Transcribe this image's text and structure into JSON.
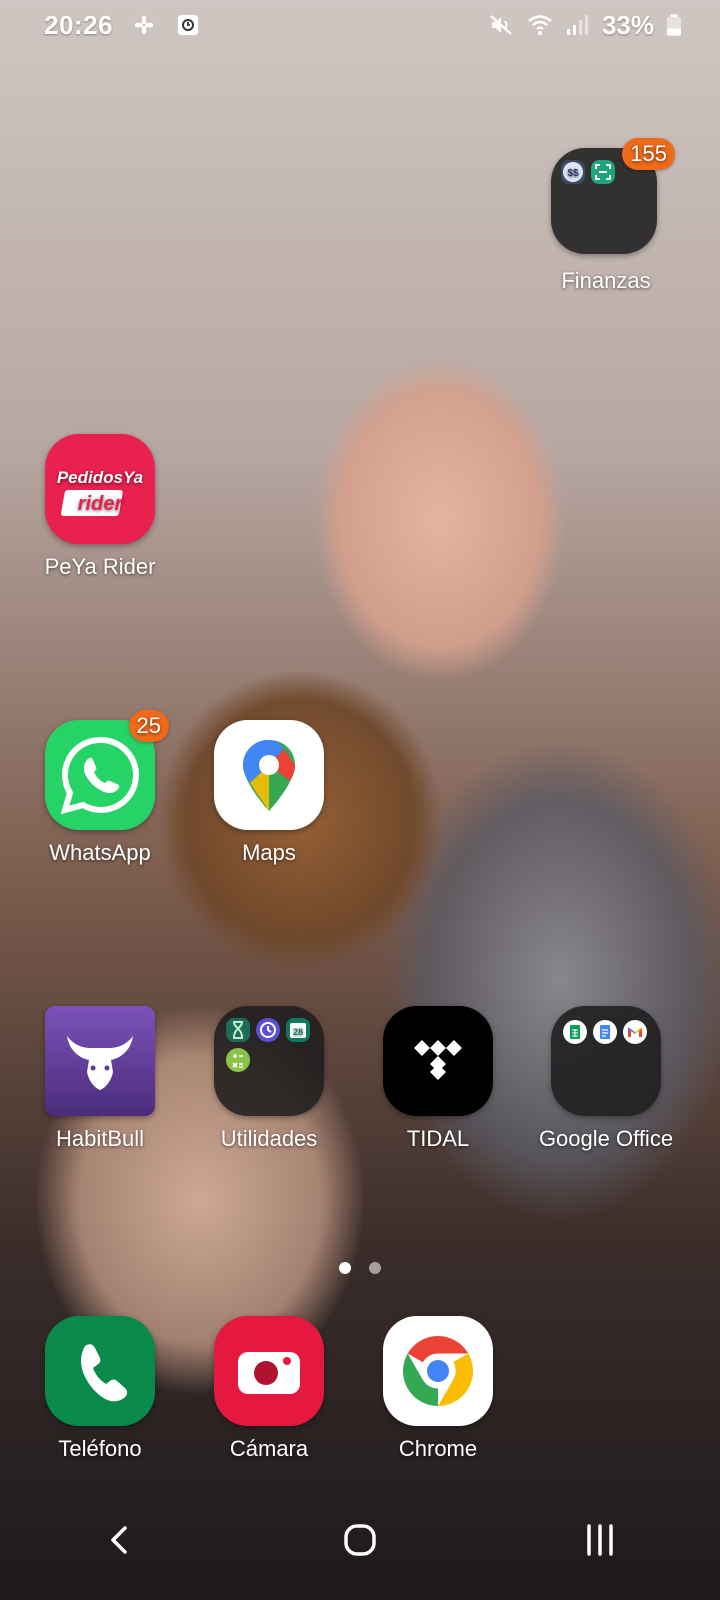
{
  "status_bar": {
    "time": "20:26",
    "battery_text": "33%",
    "icons": [
      "fan-icon",
      "clock-app-icon",
      "mute-icon",
      "wifi-icon",
      "signal-icon",
      "battery-icon"
    ]
  },
  "apps": {
    "finanzas": {
      "label": "Finanzas",
      "badge": "155",
      "mini_labels": [
        "$$",
        "scan"
      ]
    },
    "peya_rider": {
      "label": "PeYa Rider",
      "logo_top": "PedidosYa",
      "logo_bottom": "rider"
    },
    "whatsapp": {
      "label": "WhatsApp",
      "badge": "25"
    },
    "maps": {
      "label": "Maps"
    },
    "habitbull": {
      "label": "HabitBull"
    },
    "utilidades": {
      "label": "Utilidades",
      "mini_calendar": "28"
    },
    "tidal": {
      "label": "TIDAL"
    },
    "google_office": {
      "label": "Google Office"
    }
  },
  "dock": {
    "telefono": {
      "label": "Teléfono"
    },
    "camara": {
      "label": "Cámara"
    },
    "chrome": {
      "label": "Chrome"
    }
  },
  "page_indicator": {
    "pages": 2,
    "active": 1
  },
  "colors": {
    "badge": "#ef6a19",
    "peya": "#e8214f",
    "whatsapp": "#25d366",
    "habitbull": "#5b3a8c",
    "telefono": "#0a8a4a",
    "camara": "#e5193f"
  }
}
